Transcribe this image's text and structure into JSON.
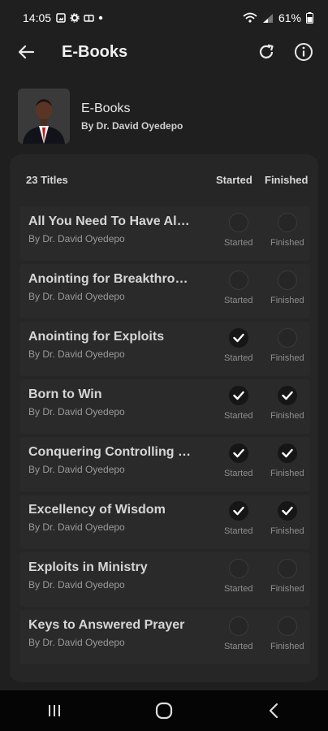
{
  "status": {
    "time": "14:05",
    "battery": "61%"
  },
  "appbar": {
    "title": "E-Books"
  },
  "header": {
    "title": "E-Books",
    "author": "By Dr. David Oyedepo"
  },
  "list": {
    "count_label": "23 Titles",
    "started_header": "Started",
    "finished_header": "Finished",
    "items": [
      {
        "title": "All You Need To Have All ...",
        "author": "By Dr. David Oyedepo",
        "started": false,
        "finished": false,
        "started_label": "Started",
        "finished_label": "Finished"
      },
      {
        "title": "Anointing for Breakthrou...",
        "author": "By Dr. David Oyedepo",
        "started": false,
        "finished": false,
        "started_label": "Started",
        "finished_label": "Finished"
      },
      {
        "title": "Anointing for Exploits",
        "author": "By Dr. David Oyedepo",
        "started": true,
        "finished": false,
        "started_label": "Started",
        "finished_label": "Finished"
      },
      {
        "title": "Born to Win",
        "author": "By Dr. David Oyedepo",
        "started": true,
        "finished": true,
        "started_label": "Started",
        "finished_label": "Finished"
      },
      {
        "title": "Conquering Controlling P...",
        "author": "By Dr. David Oyedepo",
        "started": true,
        "finished": true,
        "started_label": "Started",
        "finished_label": "Finished"
      },
      {
        "title": "Excellency of Wisdom",
        "author": "By Dr. David Oyedepo",
        "started": true,
        "finished": true,
        "started_label": "Started",
        "finished_label": "Finished"
      },
      {
        "title": "Exploits in Ministry",
        "author": "By Dr. David Oyedepo",
        "started": false,
        "finished": false,
        "started_label": "Started",
        "finished_label": "Finished"
      },
      {
        "title": "Keys to Answered Prayer",
        "author": "By Dr. David Oyedepo",
        "started": false,
        "finished": false,
        "started_label": "Started",
        "finished_label": "Finished"
      }
    ]
  },
  "icons": {
    "back": "arrow-back-icon",
    "refresh": "refresh-icon",
    "info": "info-icon",
    "check": "check-icon"
  },
  "colors": {
    "background": "#1f1f1f",
    "panel": "#262626",
    "row": "#2a2a2a",
    "navbar": "#050505"
  }
}
